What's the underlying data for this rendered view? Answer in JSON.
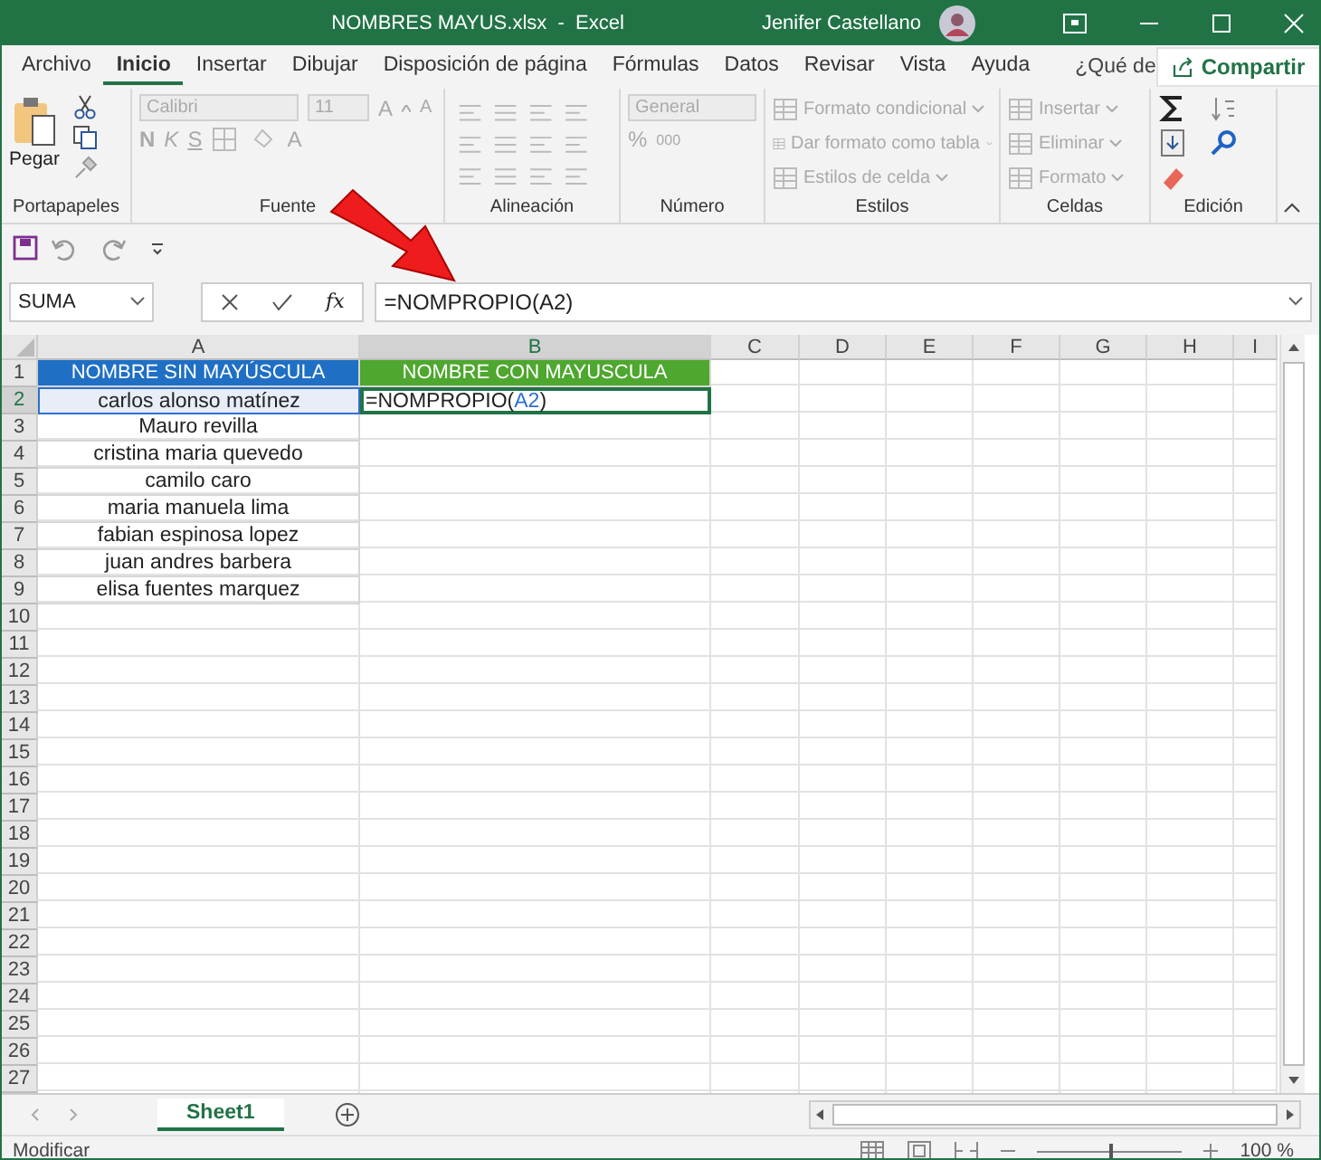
{
  "window": {
    "title": "NOMBRES MAYUS.xlsx  -  Excel",
    "user": "Jenifer Castellano"
  },
  "menu_tabs": [
    {
      "label": "Archivo",
      "selected": false
    },
    {
      "label": "Inicio",
      "selected": true
    },
    {
      "label": "Insertar",
      "selected": false
    },
    {
      "label": "Dibujar",
      "selected": false
    },
    {
      "label": "Disposición de página",
      "selected": false
    },
    {
      "label": "Fórmulas",
      "selected": false
    },
    {
      "label": "Datos",
      "selected": false
    },
    {
      "label": "Revisar",
      "selected": false
    },
    {
      "label": "Vista",
      "selected": false
    },
    {
      "label": "Ayuda",
      "selected": false
    }
  ],
  "tell_me": "¿Qué de",
  "share_button": "Compartir",
  "ribbon": {
    "groups": [
      {
        "kind": "clipboard",
        "label": "Portapapeles",
        "disabled": false,
        "paste": "Pegar"
      },
      {
        "kind": "font",
        "label": "Fuente",
        "disabled": true,
        "font": "Calibri",
        "size": "11",
        "grow": "A",
        "shrink": "A",
        "bold": "N",
        "italic": "K",
        "underline": "S",
        "font_color": "A"
      },
      {
        "kind": "alignment",
        "label": "Alineación",
        "disabled": true
      },
      {
        "kind": "number",
        "label": "Número",
        "disabled": true,
        "format": "General",
        "percent": "%",
        "thousands": "000"
      },
      {
        "kind": "styles",
        "label": "Estilos",
        "disabled": true,
        "items": [
          "Formato condicional",
          "Dar formato como tabla",
          "Estilos de celda"
        ]
      },
      {
        "kind": "cells",
        "label": "Celdas",
        "disabled": true,
        "items": [
          "Insertar",
          "Eliminar",
          "Formato"
        ]
      },
      {
        "kind": "editing",
        "label": "Edición",
        "disabled": false
      }
    ]
  },
  "formula_bar": {
    "name_box": "SUMA",
    "function_symbol": "fx",
    "formula": "=NOMPROPIO(A2)"
  },
  "sheet": {
    "columns": [
      {
        "label": "A",
        "selected": false
      },
      {
        "label": "B",
        "selected": true
      },
      {
        "label": "C",
        "selected": false
      },
      {
        "label": "D",
        "selected": false
      },
      {
        "label": "E",
        "selected": false
      },
      {
        "label": "F",
        "selected": false
      },
      {
        "label": "G",
        "selected": false
      },
      {
        "label": "H",
        "selected": false
      },
      {
        "label": "I",
        "selected": false
      }
    ],
    "rows": [
      {
        "number": "1",
        "selected": false,
        "cells": [
          {
            "kind": "header",
            "text": "NOMBRE SIN MAYÚSCULA",
            "color": "#1f6fc5"
          },
          {
            "kind": "header",
            "text": "NOMBRE CON MAYUSCULA",
            "color": "#4ea72e"
          }
        ]
      },
      {
        "number": "2",
        "selected": true,
        "cells": [
          {
            "kind": "text",
            "text": "carlos alonso matínez",
            "referenced": true,
            "selected": false
          },
          {
            "kind": "formula",
            "parts": [
              {
                "text": "=NOMPROPIO(",
                "ref": false
              },
              {
                "text": "A2",
                "ref": true
              },
              {
                "text": ")",
                "ref": false
              }
            ],
            "referenced": false,
            "selected": true
          }
        ]
      },
      {
        "number": "3",
        "selected": false,
        "cells": [
          {
            "kind": "text",
            "text": "Mauro revilla"
          }
        ]
      },
      {
        "number": "4",
        "selected": false,
        "cells": [
          {
            "kind": "text",
            "text": "cristina maria quevedo"
          }
        ]
      },
      {
        "number": "5",
        "selected": false,
        "cells": [
          {
            "kind": "text",
            "text": "camilo caro"
          }
        ]
      },
      {
        "number": "6",
        "selected": false,
        "cells": [
          {
            "kind": "text",
            "text": "maria manuela lima"
          }
        ]
      },
      {
        "number": "7",
        "selected": false,
        "cells": [
          {
            "kind": "text",
            "text": "fabian espinosa lopez"
          }
        ]
      },
      {
        "number": "8",
        "selected": false,
        "cells": [
          {
            "kind": "text",
            "text": "juan andres barbera"
          }
        ]
      },
      {
        "number": "9",
        "selected": false,
        "cells": [
          {
            "kind": "text",
            "text": "elisa fuentes marquez"
          }
        ]
      },
      {
        "number": "10",
        "selected": false
      },
      {
        "number": "11",
        "selected": false
      },
      {
        "number": "12",
        "selected": false
      },
      {
        "number": "13",
        "selected": false
      },
      {
        "number": "14",
        "selected": false
      },
      {
        "number": "15",
        "selected": false
      },
      {
        "number": "16",
        "selected": false
      },
      {
        "number": "17",
        "selected": false
      },
      {
        "number": "18",
        "selected": false
      },
      {
        "number": "19",
        "selected": false
      },
      {
        "number": "20",
        "selected": false
      },
      {
        "number": "21",
        "selected": false
      },
      {
        "number": "22",
        "selected": false
      },
      {
        "number": "23",
        "selected": false
      },
      {
        "number": "24",
        "selected": false
      },
      {
        "number": "25",
        "selected": false
      },
      {
        "number": "26",
        "selected": false
      },
      {
        "number": "27",
        "selected": false
      }
    ]
  },
  "sheet_tabs": [
    {
      "label": "Sheet1",
      "selected": true
    }
  ],
  "status_bar": {
    "mode": "Modificar",
    "zoom": {
      "level": 0.5
    },
    "zoom_reading": "100 %"
  }
}
